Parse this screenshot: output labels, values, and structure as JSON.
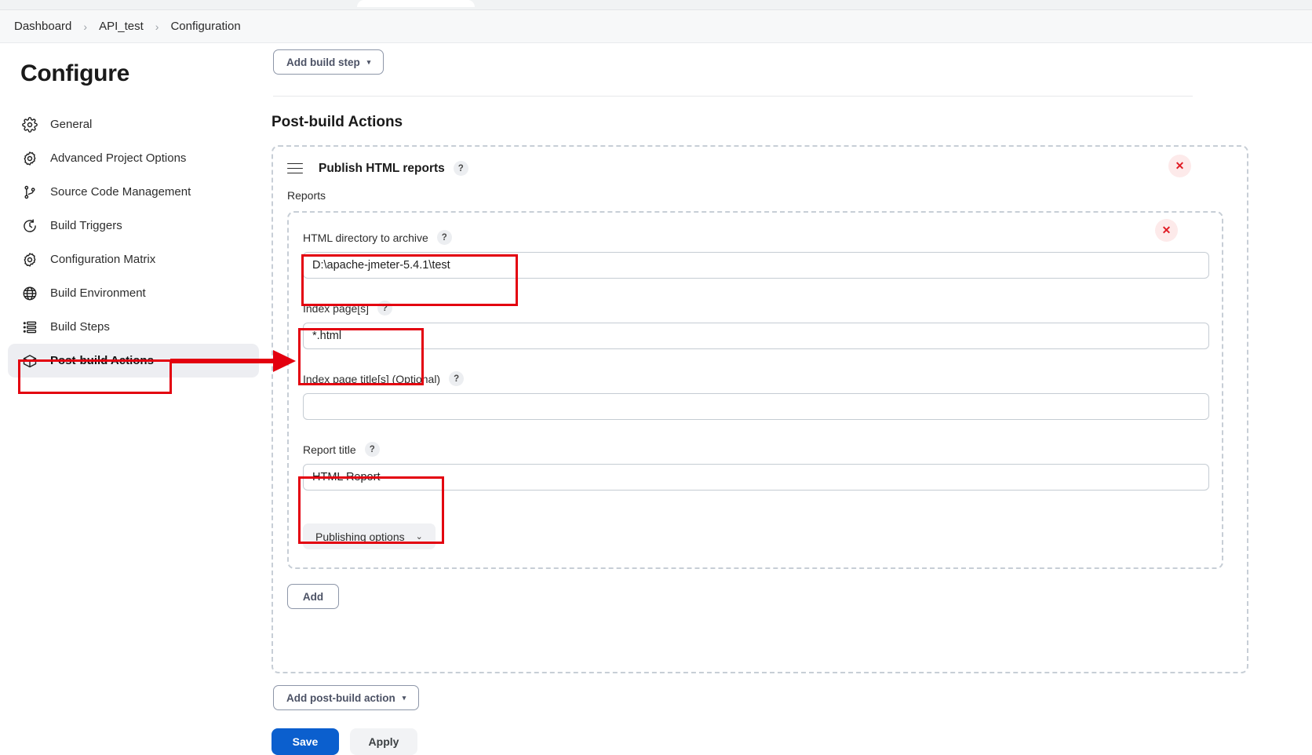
{
  "breadcrumb": {
    "items": [
      "Dashboard",
      "API_test",
      "Configuration"
    ],
    "separator": "›"
  },
  "sidebar": {
    "title": "Configure",
    "items": [
      {
        "label": "General",
        "icon": "gear-icon",
        "active": false
      },
      {
        "label": "Advanced Project Options",
        "icon": "gear-outline-icon",
        "active": false
      },
      {
        "label": "Source Code Management",
        "icon": "git-branch-icon",
        "active": false
      },
      {
        "label": "Build Triggers",
        "icon": "clock-icon",
        "active": false
      },
      {
        "label": "Configuration Matrix",
        "icon": "gear-outline-icon",
        "active": false
      },
      {
        "label": "Build Environment",
        "icon": "globe-icon",
        "active": false
      },
      {
        "label": "Build Steps",
        "icon": "list-icon",
        "active": false
      },
      {
        "label": "Post-build Actions",
        "icon": "package-icon",
        "active": true
      }
    ]
  },
  "main": {
    "add_build_step_label": "Add build step",
    "add_build_step_caret": "▾",
    "section_heading": "Post-build Actions",
    "card": {
      "title": "Publish HTML reports",
      "help": "?",
      "reports_label": "Reports",
      "close_label": "✕",
      "fields": [
        {
          "label": "HTML directory to archive",
          "help": "?",
          "value": "D:\\apache-jmeter-5.4.1\\test",
          "placeholder": ""
        },
        {
          "label": "Index page[s]",
          "help": "?",
          "value": "*.html",
          "placeholder": ""
        },
        {
          "label": "Index page title[s] (Optional)",
          "help": "?",
          "value": "",
          "placeholder": ""
        },
        {
          "label": "Report title",
          "help": "?",
          "value": "HTML Report",
          "placeholder": ""
        }
      ],
      "publishing_options_label": "Publishing options",
      "publishing_options_chevron": "⌄",
      "add_label": "Add"
    },
    "add_post_build_label": "Add post-build action",
    "add_post_build_caret": "▾"
  },
  "footer": {
    "save_label": "Save",
    "apply_label": "Apply"
  },
  "colors": {
    "accent_blue": "#0b5fce",
    "annotation_red": "#e3000f",
    "close_red": "#e01b24",
    "dashed_border": "#c7ced6"
  }
}
